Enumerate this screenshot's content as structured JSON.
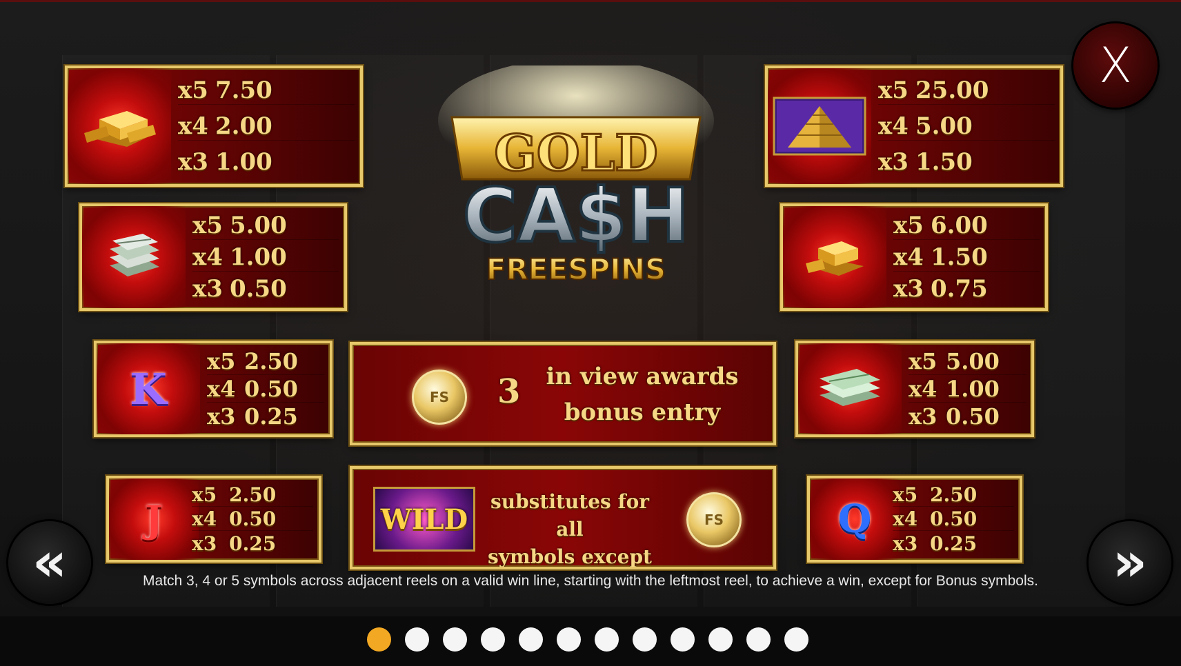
{
  "close_label": "X",
  "nav": {
    "prev_label": "«",
    "next_label": "»"
  },
  "logo": {
    "gold": "GOLD",
    "cash": "CA$H",
    "freespins": "FREESPINS"
  },
  "paytable": {
    "gold_bar": [
      {
        "mult": "x5",
        "value": "7.50"
      },
      {
        "mult": "x4",
        "value": "2.00"
      },
      {
        "mult": "x3",
        "value": "1.00"
      }
    ],
    "gold_pyramid": [
      {
        "mult": "x5",
        "value": "25.00"
      },
      {
        "mult": "x4",
        "value": "5.00"
      },
      {
        "mult": "x3",
        "value": "1.50"
      }
    ],
    "cash_stack_small": [
      {
        "mult": "x5",
        "value": "5.00"
      },
      {
        "mult": "x4",
        "value": "1.00"
      },
      {
        "mult": "x3",
        "value": "0.50"
      }
    ],
    "gold_bars_small": [
      {
        "mult": "x5",
        "value": "6.00"
      },
      {
        "mult": "x4",
        "value": "1.50"
      },
      {
        "mult": "x3",
        "value": "0.75"
      }
    ],
    "letter_k": [
      {
        "mult": "x5",
        "value": "2.50"
      },
      {
        "mult": "x4",
        "value": "0.50"
      },
      {
        "mult": "x3",
        "value": "0.25"
      }
    ],
    "cash_stack": [
      {
        "mult": "x5",
        "value": "5.00"
      },
      {
        "mult": "x4",
        "value": "1.00"
      },
      {
        "mult": "x3",
        "value": "0.50"
      }
    ],
    "letter_j": [
      {
        "mult": "x5",
        "value": "2.50"
      },
      {
        "mult": "x4",
        "value": "0.50"
      },
      {
        "mult": "x3",
        "value": "0.25"
      }
    ],
    "letter_q": [
      {
        "mult": "x5",
        "value": "2.50"
      },
      {
        "mult": "x4",
        "value": "0.50"
      },
      {
        "mult": "x3",
        "value": "0.25"
      }
    ]
  },
  "symbols": {
    "k": "K",
    "j": "J",
    "q": "Q",
    "wild": "WILD",
    "fs": "FS"
  },
  "bonus": {
    "count": "3",
    "line1": "in view awards",
    "line2": "bonus entry"
  },
  "wild_panel": {
    "line1": "substitutes for all",
    "line2": "symbols except"
  },
  "footer": "Match 3, 4 or 5 symbols across adjacent reels on a valid win line, starting with the leftmost reel, to achieve a win, except for Bonus symbols.",
  "pagination": {
    "total": 12,
    "active": 1
  },
  "colors": {
    "gold": "#e7c86a",
    "panel_red": "#8a0606",
    "active_dot": "#f3a823"
  }
}
